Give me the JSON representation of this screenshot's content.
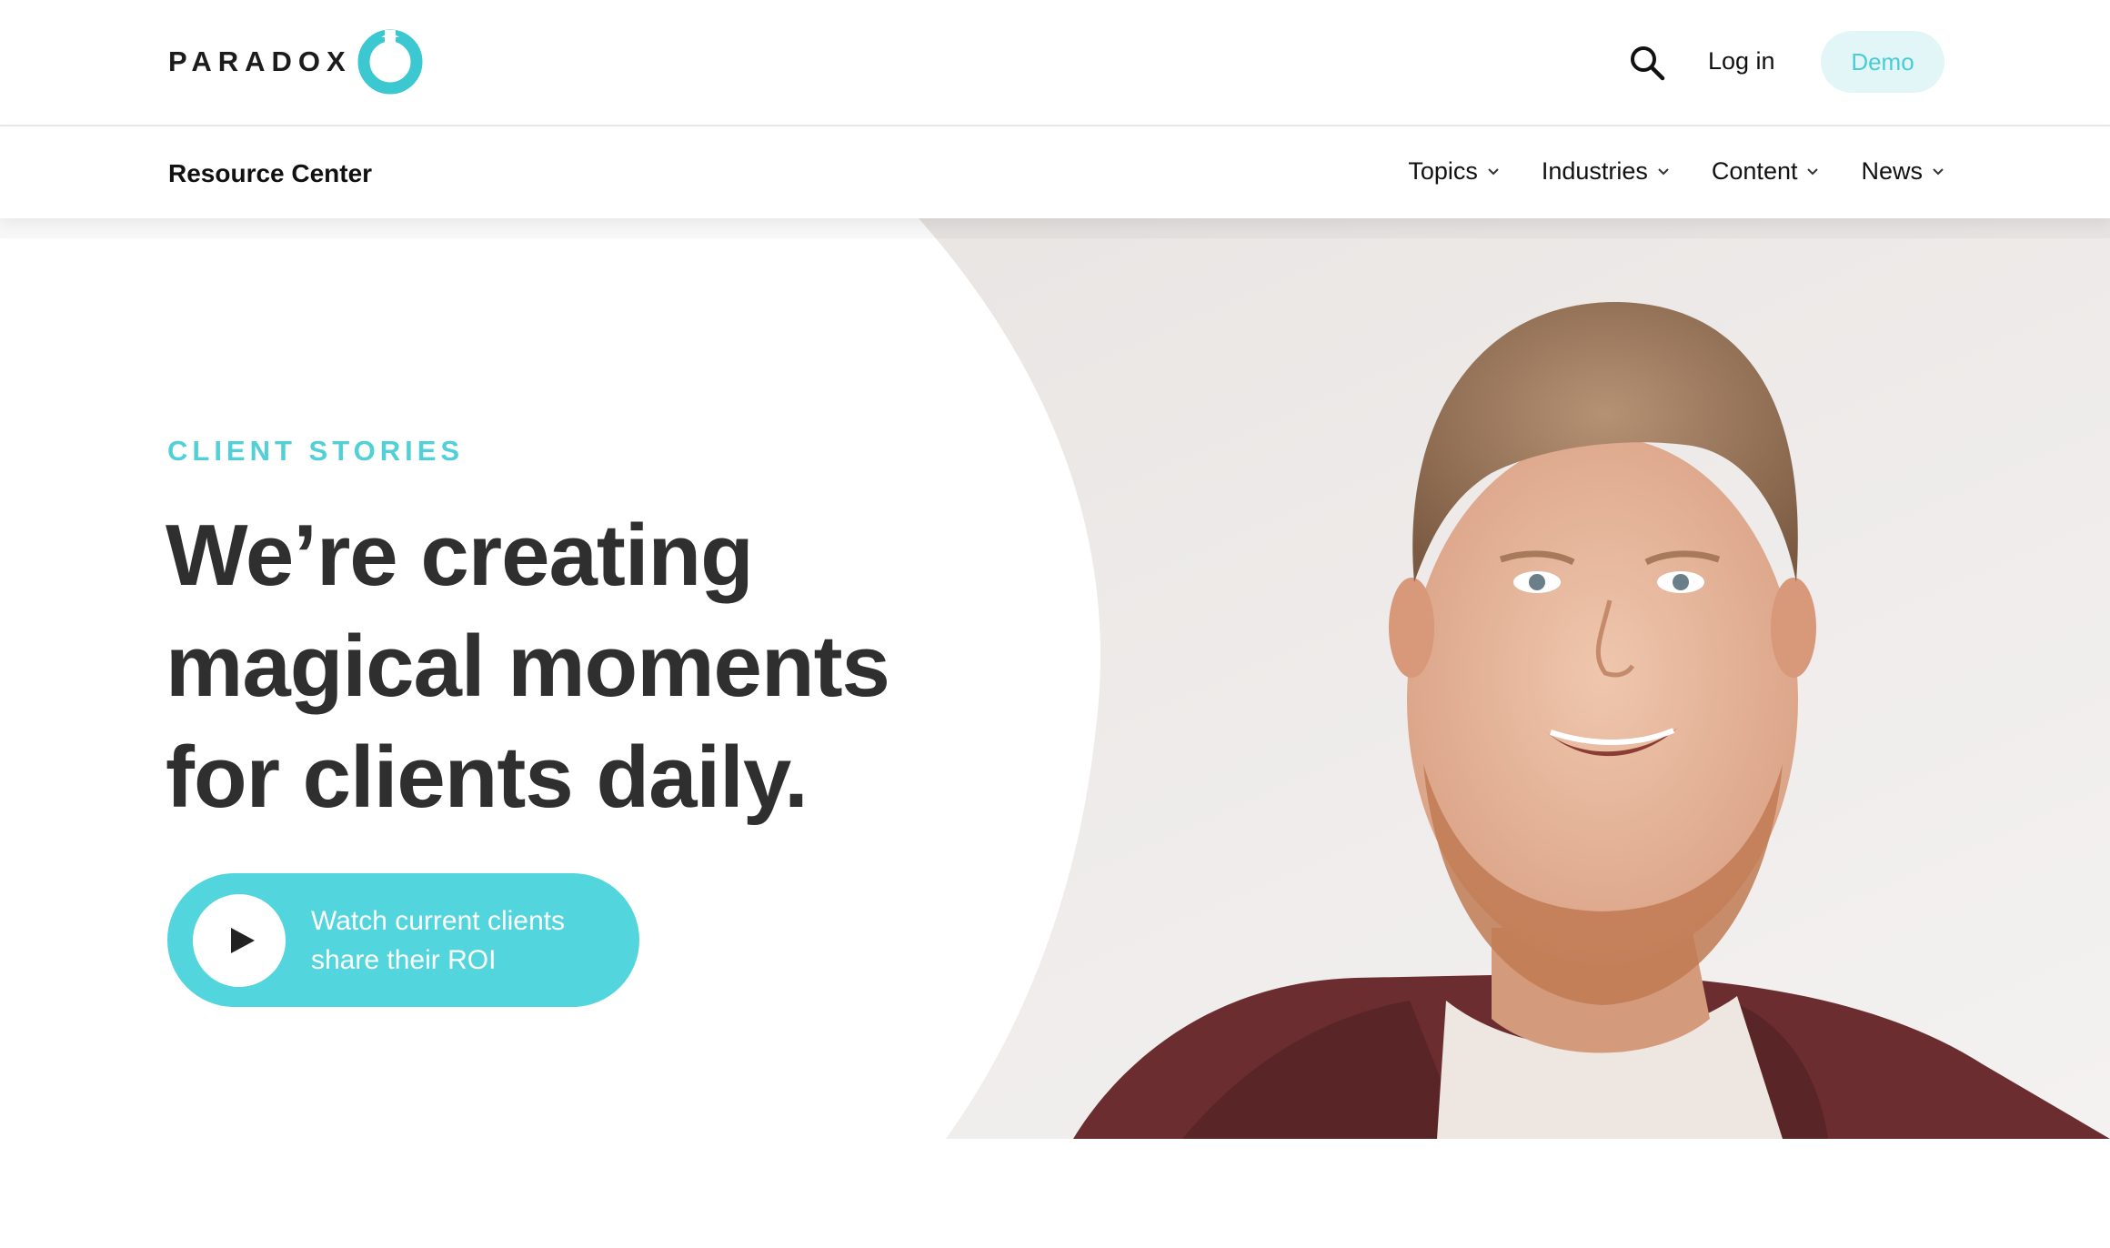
{
  "header": {
    "logo_text": "PARADOX",
    "login_label": "Log in",
    "demo_label": "Demo"
  },
  "subnav": {
    "title": "Resource Center",
    "menu": [
      {
        "label": "Topics"
      },
      {
        "label": "Industries"
      },
      {
        "label": "Content"
      },
      {
        "label": "News"
      }
    ]
  },
  "hero": {
    "eyebrow": "CLIENT STORIES",
    "headline": "We’re creating magical moments for clients daily.",
    "cta_label": "Watch current clients share their ROI"
  },
  "icons": {
    "logo": "paradox-ring-logo",
    "search": "search-icon",
    "chevron": "chevron-down-icon",
    "play": "play-icon"
  },
  "colors": {
    "accent": "#52d5dc",
    "accent_text": "#48cdd5",
    "demo_bg": "#e2f6f7",
    "headline": "#2f2f2f"
  }
}
